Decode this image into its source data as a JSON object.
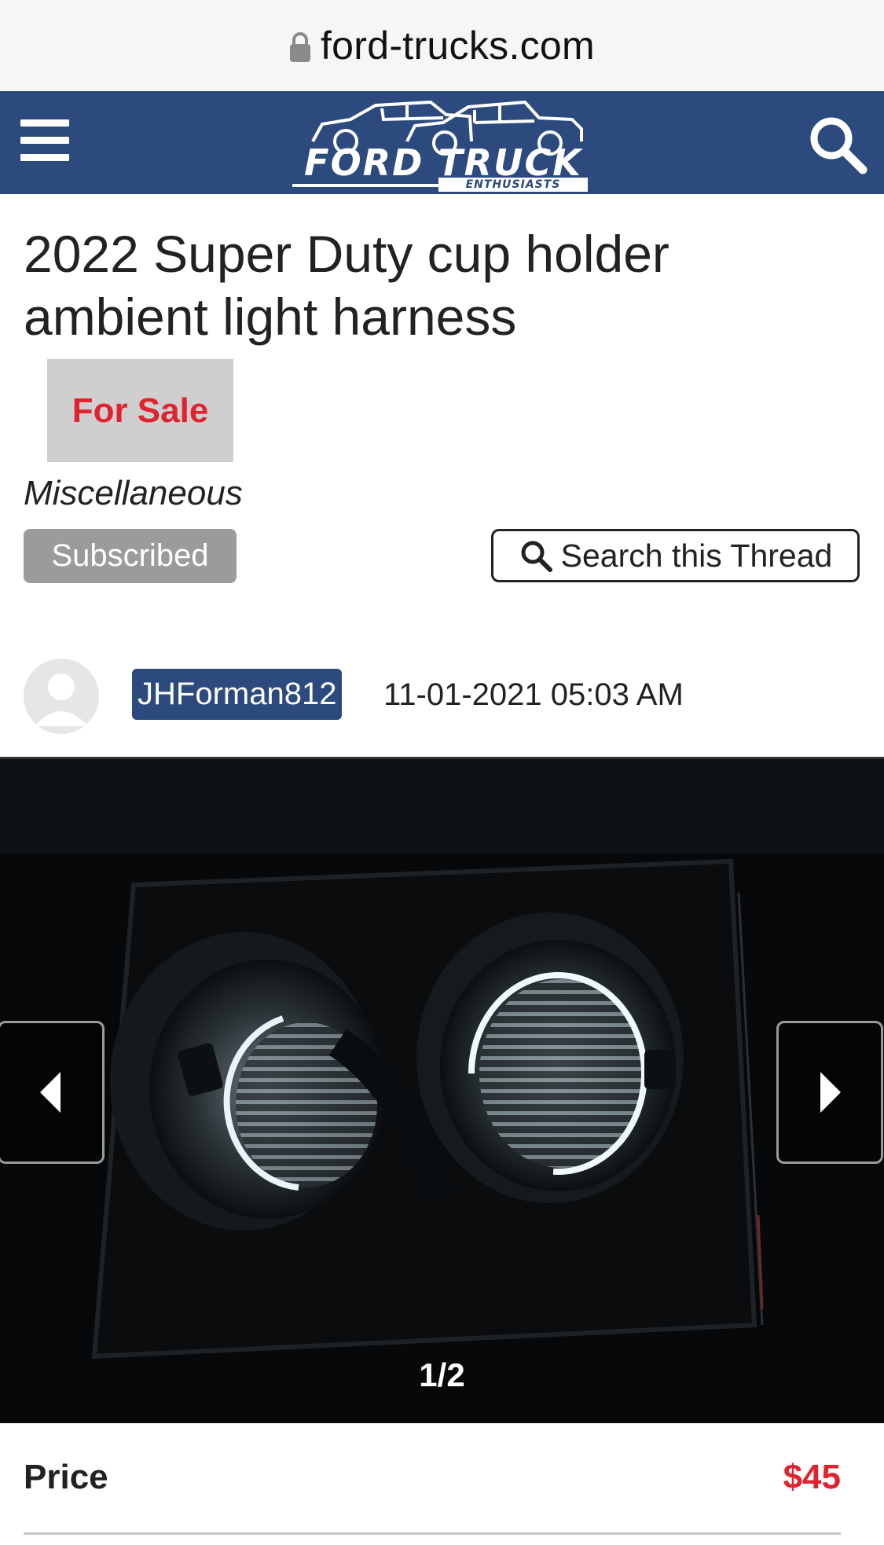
{
  "browser": {
    "domain": "ford-trucks.com"
  },
  "header": {
    "logo_main": "FORD TRUCK",
    "logo_sub": "ENTHUSIASTS"
  },
  "thread": {
    "title": "2022 Super Duty cup holder ambient light harness",
    "prefix": "For Sale",
    "category": "Miscellaneous",
    "subscribed_label": "Subscribed",
    "search_label": "Search this Thread"
  },
  "post": {
    "username": "JHForman812",
    "date": "11-01-2021 05:03 AM"
  },
  "gallery": {
    "counter": "1/2"
  },
  "listing": {
    "price_label": "Price",
    "price_value": "$45"
  },
  "colors": {
    "brand_blue": "#2c4a7d",
    "sale_red": "#e0242f"
  },
  "icons": [
    "lock-icon",
    "menu-icon",
    "search-icon",
    "avatar-icon",
    "chevron-left-icon",
    "chevron-right-icon"
  ]
}
